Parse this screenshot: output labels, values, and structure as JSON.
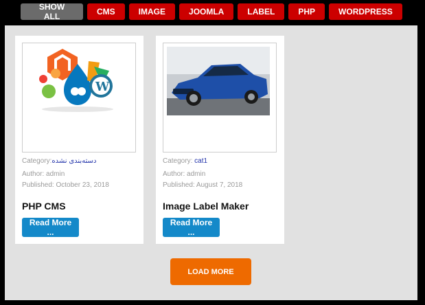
{
  "filters": [
    {
      "label": "SHOW ALL"
    },
    {
      "label": "CMS"
    },
    {
      "label": "IMAGE"
    },
    {
      "label": "JOOMLA"
    },
    {
      "label": "LABEL"
    },
    {
      "label": "PHP"
    },
    {
      "label": "WORDPRESS"
    }
  ],
  "cards": [
    {
      "category_label": "Category:",
      "category_value": "دسته‌بندی نشده",
      "author": "Author: admin",
      "published": "Published: October 23, 2018",
      "title": "PHP CMS",
      "read_more": "Read More ..."
    },
    {
      "category_label": "Category:",
      "category_value": "cat1",
      "author": "Author: admin",
      "published": "Published: August 7, 2018",
      "title": "Image Label Maker",
      "read_more": "Read More ..."
    }
  ],
  "load_more": "LOAD MORE",
  "colors": {
    "active_filter": "#6b6b6b",
    "filter": "#cc0000",
    "read_more": "#1489c9",
    "load_more": "#ee6a00",
    "panel": "#e1e1e1"
  }
}
